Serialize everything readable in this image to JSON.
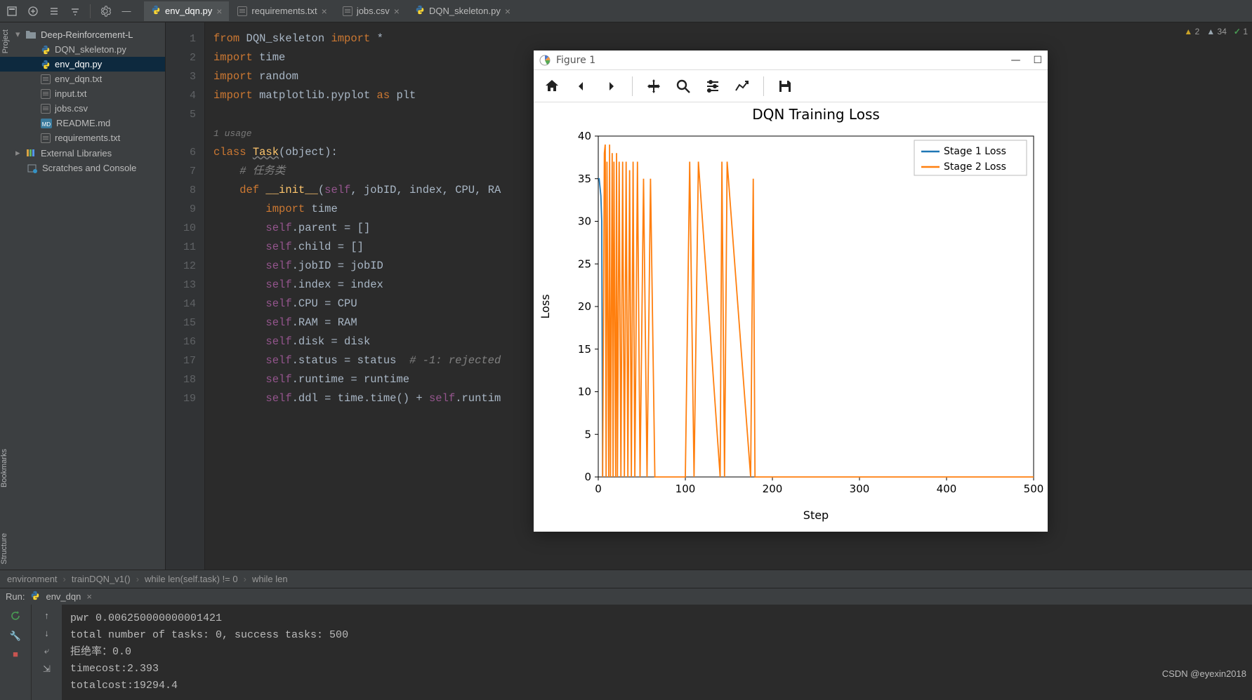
{
  "project_label": "Project",
  "side_bookmark": "Bookmarks",
  "side_structure": "Structure",
  "tabs": [
    {
      "label": "env_dqn.py",
      "active": true,
      "icon": "python"
    },
    {
      "label": "requirements.txt",
      "active": false,
      "icon": "text"
    },
    {
      "label": "jobs.csv",
      "active": false,
      "icon": "csv"
    },
    {
      "label": "DQN_skeleton.py",
      "active": false,
      "icon": "python"
    }
  ],
  "tree": {
    "root": "Deep-Reinforcement-L",
    "items": [
      {
        "label": "DQN_skeleton.py",
        "icon": "python"
      },
      {
        "label": "env_dqn.py",
        "icon": "python",
        "sel": true
      },
      {
        "label": "env_dqn.txt",
        "icon": "text"
      },
      {
        "label": "input.txt",
        "icon": "text"
      },
      {
        "label": "jobs.csv",
        "icon": "csv"
      },
      {
        "label": "README.md",
        "icon": "md"
      },
      {
        "label": "requirements.txt",
        "icon": "text"
      }
    ],
    "ext": "External Libraries",
    "scratch": "Scratches and Console"
  },
  "gutter": [
    "1",
    "2",
    "3",
    "4",
    "5",
    "",
    "6",
    "7",
    "8",
    "9",
    "10",
    "11",
    "12",
    "13",
    "14",
    "15",
    "16",
    "17",
    "18",
    "19"
  ],
  "usage": "1 usage",
  "code": {
    "l1a": "from",
    "l1b": " DQN_skeleton ",
    "l1c": "import",
    "l1d": " *",
    "l2a": "import",
    "l2b": " time",
    "l3a": "import",
    "l3b": " random",
    "l4a": "import",
    "l4b": " matplotlib.pyplot ",
    "l4c": "as",
    "l4d": " plt",
    "l6a": "class ",
    "l6b": "Task",
    "l6c": "(",
    "l6d": "object",
    "l6e": "):",
    "l7": "    # 任务类",
    "l8a": "    def ",
    "l8b": "__init__",
    "l8c": "(",
    "l8d": "self",
    "l8e": ", jobID, index, CPU, RA",
    "l9a": "        import",
    "l9b": " time",
    "l10a": "        self",
    "l10b": ".parent = []",
    "l11a": "        self",
    "l11b": ".child = []",
    "l12a": "        self",
    "l12b": ".jobID = jobID",
    "l13a": "        self",
    "l13b": ".index = index",
    "l14a": "        self",
    "l14b": ".CPU = CPU",
    "l15a": "        self",
    "l15b": ".RAM = RAM",
    "l16a": "        self",
    "l16b": ".disk = disk",
    "l17a": "        self",
    "l17b": ".status = status  ",
    "l17c": "# -1: rejected",
    "l18a": "        self",
    "l18b": ".runtime = runtime",
    "l19a": "        self",
    "l19b": ".ddl = time.time() + ",
    "l19c": "self",
    "l19d": ".runtim"
  },
  "warnings": {
    "w1": "2",
    "w2": "34",
    "w3": "1"
  },
  "breadcrumb": [
    "environment",
    "trainDQN_v1()",
    "while len(self.task) != 0",
    "while len"
  ],
  "run": {
    "title": "Run:",
    "tab": "env_dqn",
    "lines": [
      "pwr 0.006250000000001421",
      "total number of tasks: 0, success tasks: 500",
      "拒绝率：0.0",
      "timecost:2.393",
      "totalcost:19294.4"
    ]
  },
  "mpl": {
    "title": "Figure 1",
    "toolbar": [
      "home",
      "back",
      "forward",
      "|",
      "pan",
      "zoom",
      "configure",
      "subplots",
      "|",
      "save"
    ]
  },
  "watermark": "CSDN @eyexin2018",
  "chart_data": {
    "type": "line",
    "title": "DQN Training Loss",
    "xlabel": "Step",
    "ylabel": "Loss",
    "xlim": [
      0,
      500
    ],
    "ylim": [
      0,
      40
    ],
    "xticks": [
      0,
      100,
      200,
      300,
      400,
      500
    ],
    "yticks": [
      0,
      5,
      10,
      15,
      20,
      25,
      30,
      35,
      40
    ],
    "legend_position": "upper-right",
    "series": [
      {
        "name": "Stage 1 Loss",
        "color": "#1f77b4",
        "x": [
          0,
          1,
          2,
          3,
          4,
          5
        ],
        "y": [
          35,
          35,
          34,
          33,
          30,
          0
        ]
      },
      {
        "name": "Stage 2 Loss",
        "color": "#ff7f0e",
        "x": [
          5,
          7,
          8,
          9,
          10,
          12,
          13,
          14,
          16,
          17,
          18,
          20,
          21,
          22,
          24,
          26,
          28,
          30,
          32,
          34,
          36,
          38,
          40,
          42,
          45,
          48,
          52,
          56,
          60,
          65,
          70,
          80,
          90,
          100,
          105,
          110,
          115,
          140,
          142,
          145,
          148,
          175,
          178,
          180,
          200,
          250,
          300,
          350,
          400,
          450,
          500
        ],
        "y": [
          0,
          38,
          39,
          0,
          37,
          0,
          39,
          0,
          38,
          0,
          37,
          0,
          38,
          0,
          37,
          0,
          37,
          0,
          37,
          0,
          36,
          0,
          37,
          0,
          37,
          0,
          35,
          0,
          35,
          0,
          0,
          0,
          0,
          0,
          37,
          0,
          37,
          0,
          37,
          0,
          37,
          0,
          35,
          0,
          0,
          0,
          0,
          0,
          0,
          0,
          0
        ]
      }
    ]
  }
}
